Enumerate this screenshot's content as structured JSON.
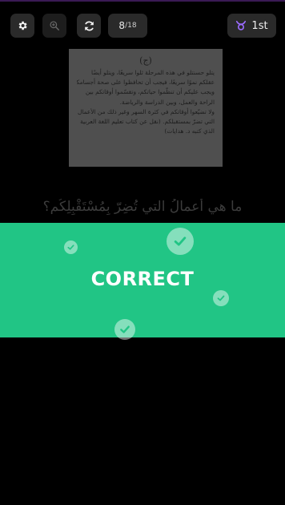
{
  "toolbar": {
    "settings_icon": "gear-icon",
    "zoom_icon": "zoom-in-icon",
    "refresh_icon": "refresh-icon",
    "counter_current": "8",
    "counter_separator": "/",
    "counter_total": "18",
    "rank_icon": "taurus-icon",
    "rank_label": "1st"
  },
  "document": {
    "header": "(ج)",
    "lines": [
      "يتلو حسنتلو في هذه المرحلة ثلوا سريعًا، ويتلو أيضًا",
      "عقلكم نموًا سريعًا، فيجب أن تحافظوا على صحة أجسامكم",
      "ويجب عليكم أن تنظّموا حياتكم، وتقسّموا أوقاتكم بين",
      "الراحة والعمل، وبين الدراسة والرياضة.",
      "ولا تضيّعوا أوقاتكم في كثرة السهر وغير ذلك من الأعمال",
      "التي تضرّ بمستقبلكم. (نقل عن كتاب تعليم اللغة العربية",
      "الذي كتبه د. هدايات)"
    ]
  },
  "question": {
    "text": "ما هي أعمالُ التي تُضِرّ بِمُسْتَقْبِلِكُم؟"
  },
  "feedback": {
    "label": "CORRECT",
    "check_icon": "check-circle-icon"
  },
  "colors": {
    "background": "#000000",
    "button_bg": "#2a2a2a",
    "correct_green": "#21c585",
    "rank_icon": "#9b6bff"
  }
}
